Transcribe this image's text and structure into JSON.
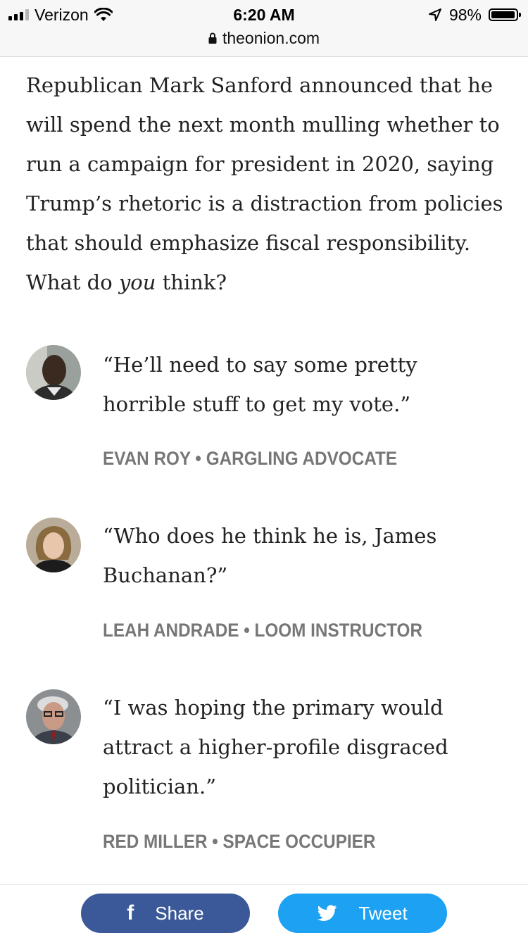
{
  "status_bar": {
    "carrier": "Verizon",
    "time": "6:20 AM",
    "battery": "98%",
    "battery_level": 0.98,
    "icons": [
      "signal-icon",
      "wifi-icon",
      "location-arrow-icon",
      "battery-icon"
    ]
  },
  "browser": {
    "url": "theonion.com",
    "lock_icon": "lock-icon"
  },
  "article": {
    "intro_before": "Republican Mark Sanford announced that he will spend the next month mulling whether to run a campaign for president in 2020, saying Trump’s rhetoric is a distraction from policies that should emphasize fiscal responsibility. What do ",
    "intro_em": "you",
    "intro_after": " think?"
  },
  "responses": [
    {
      "quote": "“He’ll need to say some pretty horrible stuff to get my vote.”",
      "byline": "EVAN ROY • GARGLING ADVOCATE"
    },
    {
      "quote": "“Who does he think he is, James Buchanan?”",
      "byline": "LEAH ANDRADE • LOOM INSTRUCTOR"
    },
    {
      "quote": "“I was hoping the primary would attract a higher-profile disgraced politician.”",
      "byline": "RED MILLER • SPACE OCCUPIER"
    }
  ],
  "share": {
    "share_label": "Share",
    "tweet_label": "Tweet",
    "facebook_icon": "facebook-icon",
    "twitter_icon": "twitter-bird-icon",
    "colors": {
      "facebook": "#3b5998",
      "twitter": "#1da1f2"
    }
  }
}
